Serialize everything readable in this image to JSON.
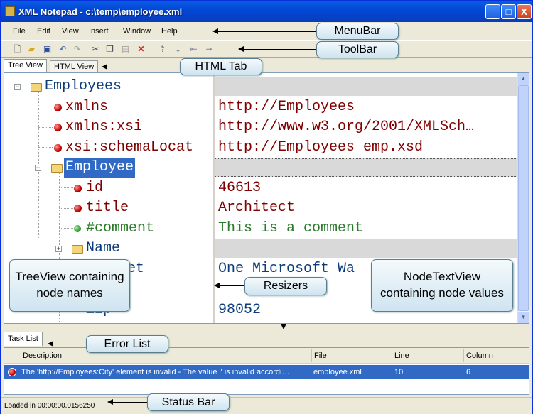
{
  "window": {
    "title": "XML Notepad - c:\\temp\\employee.xml",
    "minimize": "_",
    "maximize": "□",
    "close": "X"
  },
  "menu": [
    "File",
    "Edit",
    "View",
    "Insert",
    "Window",
    "Help"
  ],
  "toolbar_icons": [
    "new-icon",
    "open-icon",
    "save-icon",
    "undo-icon",
    "redo-icon",
    "cut-icon",
    "copy-icon",
    "paste-icon",
    "delete-icon",
    "nudge-up-icon",
    "nudge-down-icon",
    "nudge-left-icon",
    "nudge-right-icon"
  ],
  "tabs": [
    "Tree View",
    "HTML View"
  ],
  "tree": {
    "nodes": [
      "Employees",
      "xmlns",
      "xmlns:xsi",
      "xsi:schemaLocat",
      "Employee",
      "id",
      "title",
      "#comment",
      "Name",
      "et",
      "Zip"
    ]
  },
  "values": {
    "rows": [
      "",
      "http://Employees",
      "http://www.w3.org/2001/XMLSch…",
      "http://Employees emp.xsd",
      "",
      "46613",
      "Architect",
      "This is a comment",
      "",
      "One Microsoft Wa",
      "",
      "98052"
    ]
  },
  "task_list": {
    "tab": "Task List",
    "columns": [
      "Description",
      "File",
      "Line",
      "Column"
    ],
    "rows": [
      {
        "description": "The 'http://Employees:City' element is invalid - The value '' is invalid accordi…",
        "file": "employee.xml",
        "line": "10",
        "column": "6"
      }
    ]
  },
  "status": "Loaded in 00:00:00.0156250",
  "callouts": {
    "menubar": "MenuBar",
    "toolbar": "ToolBar",
    "html_tab": "HTML Tab",
    "treeview": "TreeView containing node names",
    "resizers": "Resizers",
    "nodetextview": "NodeTextView containing node values",
    "errorlist": "Error List",
    "statusbar": "Status Bar"
  },
  "colors": {
    "title_bar": "#0348d6",
    "attribute_text": "#800000",
    "element_text": "#0c3b7a",
    "comment_text": "#2a7a2a",
    "selection": "#316ac5",
    "callout_fill": "#cfe4f0"
  }
}
